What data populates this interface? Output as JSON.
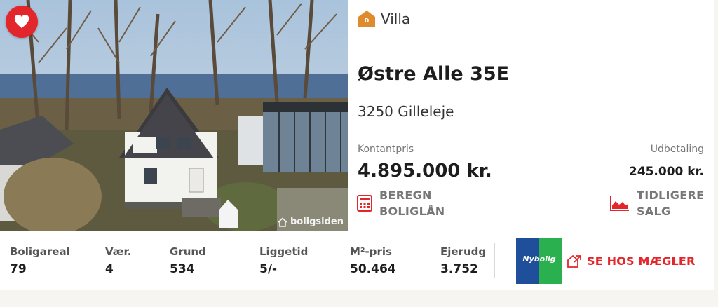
{
  "listing": {
    "type": "Villa",
    "energy_label": "D",
    "address": "Østre Alle 35E",
    "city": "3250 Gilleleje",
    "price_label": "Kontantpris",
    "price": "4.895.000 kr.",
    "down_payment_label": "Udbetaling",
    "down_payment": "245.000 kr.",
    "photo_watermark": "boligsiden"
  },
  "actions": {
    "loan": [
      "BEREGN",
      "BOLIGLÅN"
    ],
    "previous_sales": [
      "TIDLIGERE",
      "SALG"
    ],
    "broker": "SE HOS MÆGLER"
  },
  "stats": [
    {
      "label": "Boligareal",
      "value": "79"
    },
    {
      "label": "Vær.",
      "value": "4"
    },
    {
      "label": "Grund",
      "value": "534"
    },
    {
      "label": "Liggetid",
      "value": "5/-"
    },
    {
      "label": "M²-pris",
      "value": "50.464"
    },
    {
      "label": "Ejerudg",
      "value": "3.752"
    }
  ],
  "broker": {
    "logo_text": "Nybolig"
  },
  "icons": {
    "favorite": "heart-icon",
    "energy": "energy-label-badge",
    "loan": "calculator-icon",
    "sales": "chart-icon",
    "broker": "external-link-icon"
  },
  "colors": {
    "accent": "#e3262c",
    "energy_badge": "#e08a2e",
    "broker_blue": "#1f4f9a",
    "broker_green": "#2bb04f"
  }
}
